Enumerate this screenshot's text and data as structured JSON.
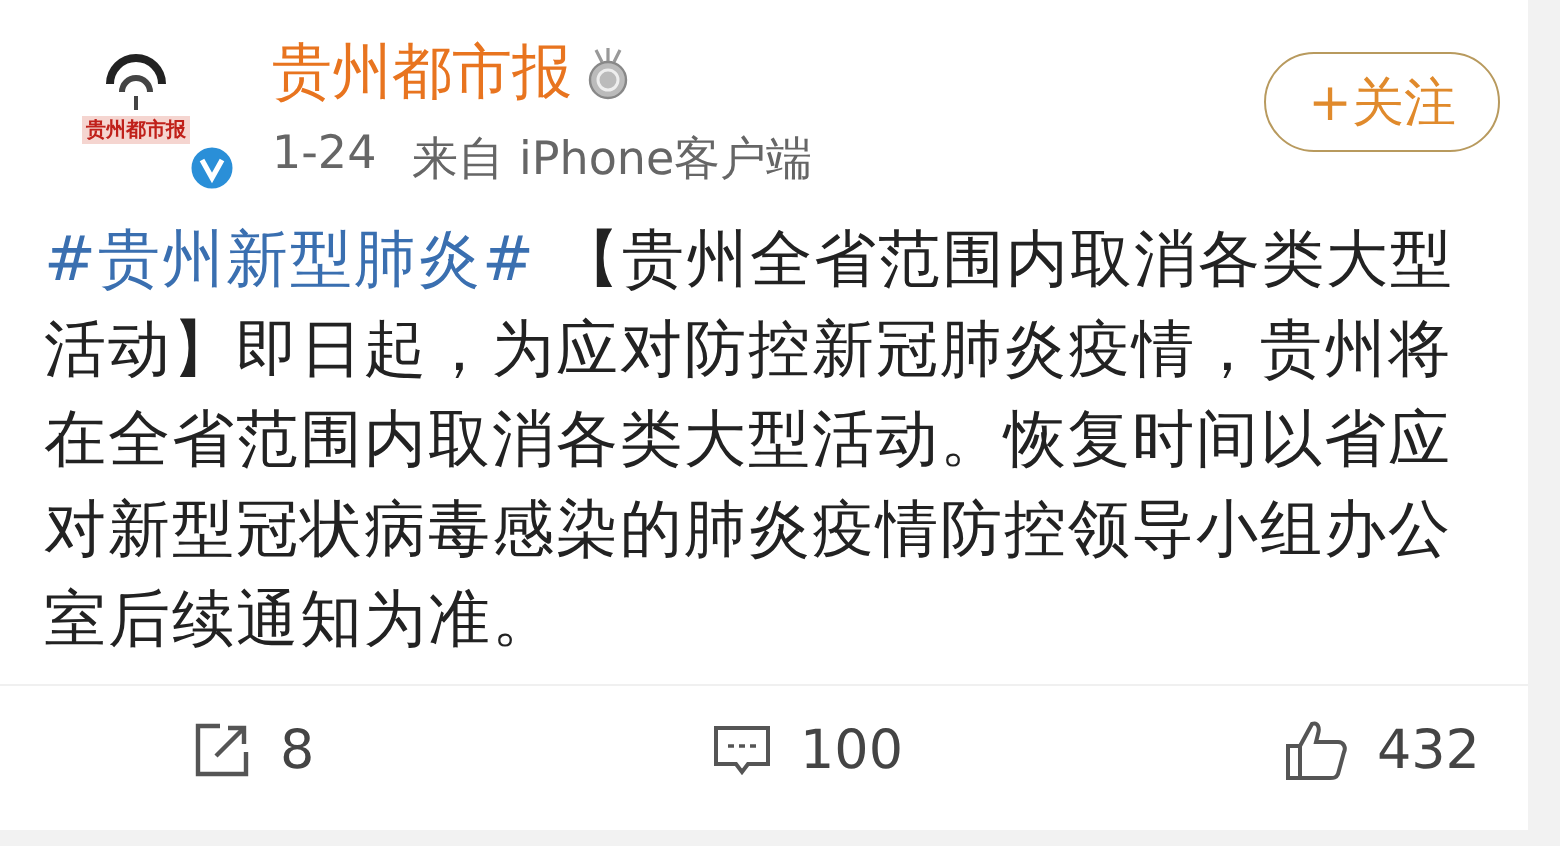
{
  "account": {
    "logo_text": "贵州都市报",
    "name": "贵州都市报",
    "verified": true,
    "time": "1-24",
    "source": "来自 iPhone客户端"
  },
  "follow_button": {
    "label": "+关注"
  },
  "post": {
    "hashtag": "#贵州新型肺炎#",
    "text": "【贵州全省范围内取消各类大型活动】即日起，为应对防控新冠肺炎疫情，贵州将在全省范围内取消各类大型活动。恢复时间以省应对新型冠状病毒感染的肺炎疫情防控领导小组办公室后续通知为准。"
  },
  "actions": [
    {
      "kind": "repost",
      "count": "8"
    },
    {
      "kind": "comment",
      "count": "100"
    },
    {
      "kind": "like",
      "count": "432"
    }
  ]
}
